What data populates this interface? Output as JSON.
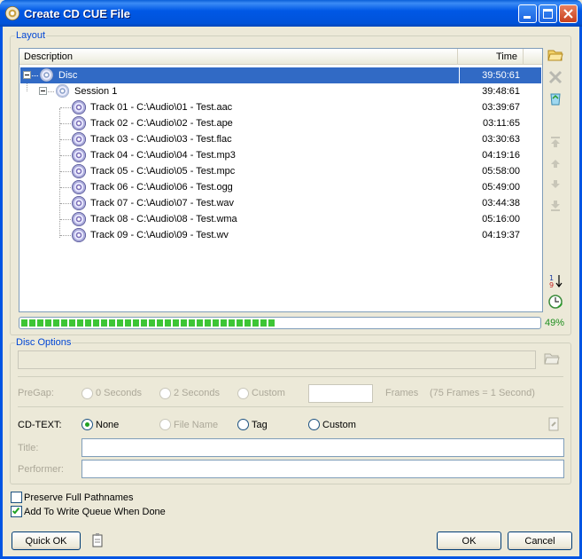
{
  "window": {
    "title": "Create CD CUE File"
  },
  "layout": {
    "group_label": "Layout",
    "columns": {
      "description": "Description",
      "time": "Time"
    },
    "disc": {
      "label": "Disc",
      "time": "39:50:61"
    },
    "session": {
      "label": "Session 1",
      "time": "39:48:61"
    },
    "tracks": [
      {
        "label": "Track 01 - C:\\Audio\\01 - Test.aac",
        "time": "03:39:67"
      },
      {
        "label": "Track 02 - C:\\Audio\\02 - Test.ape",
        "time": "03:11:65"
      },
      {
        "label": "Track 03 - C:\\Audio\\03 - Test.flac",
        "time": "03:30:63"
      },
      {
        "label": "Track 04 - C:\\Audio\\04 - Test.mp3",
        "time": "04:19:16"
      },
      {
        "label": "Track 05 - C:\\Audio\\05 - Test.mpc",
        "time": "05:58:00"
      },
      {
        "label": "Track 06 - C:\\Audio\\06 - Test.ogg",
        "time": "05:49:00"
      },
      {
        "label": "Track 07 - C:\\Audio\\07 - Test.wav",
        "time": "03:44:38"
      },
      {
        "label": "Track 08 - C:\\Audio\\08 - Test.wma",
        "time": "05:16:00"
      },
      {
        "label": "Track 09 - C:\\Audio\\09 - Test.wv",
        "time": "04:19:37"
      }
    ],
    "progress_fraction": 0.49,
    "progress_text": "49%"
  },
  "disc_options": {
    "group_label": "Disc Options",
    "pregap_label": "PreGap:",
    "pregap_options": [
      "0 Seconds",
      "2 Seconds",
      "Custom"
    ],
    "frames_label": "Frames",
    "frames_note": "(75 Frames = 1 Second)",
    "cdtext_label": "CD-TEXT:",
    "cdtext_options": [
      "None",
      "File Name",
      "Tag",
      "Custom"
    ],
    "cdtext_selected": "None",
    "title_label": "Title:",
    "performer_label": "Performer:"
  },
  "options": {
    "preserve_pathnames": "Preserve Full Pathnames",
    "preserve_checked": false,
    "add_to_queue": "Add To Write Queue When Done",
    "add_checked": true
  },
  "buttons": {
    "quick_ok": "Quick OK",
    "ok": "OK",
    "cancel": "Cancel"
  },
  "colors": {
    "selection": "#316ac5",
    "accent": "#0046d5",
    "progress": "#3dc535"
  }
}
